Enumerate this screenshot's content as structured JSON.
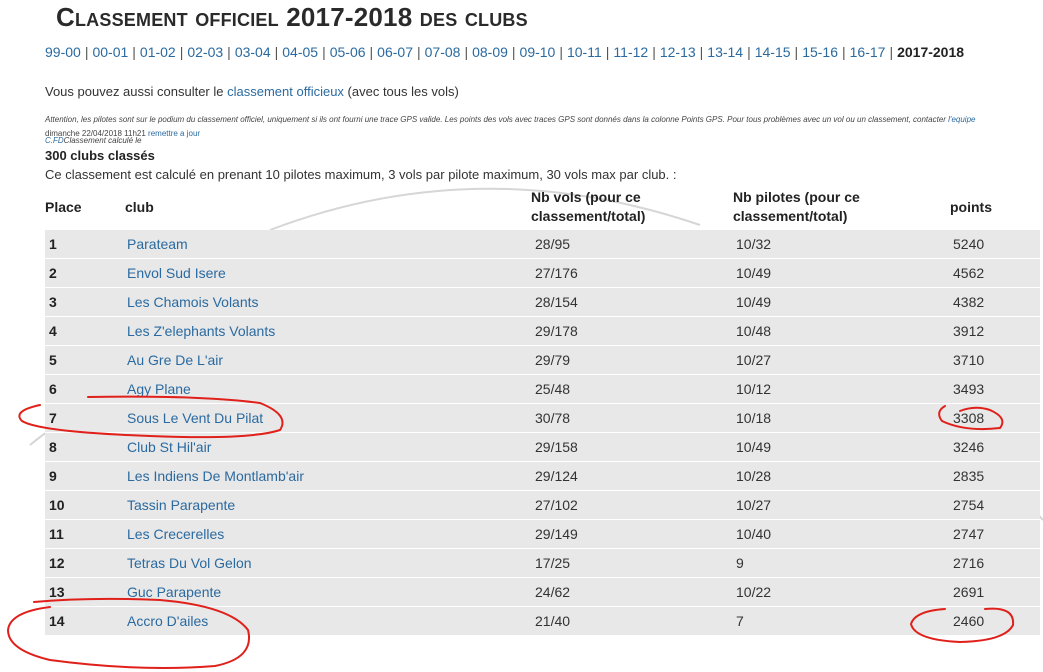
{
  "title": {
    "first_letter": "C",
    "rest": "lassement officiel 2017-2018 des clubs"
  },
  "seasons": [
    "99-00",
    "00-01",
    "01-02",
    "02-03",
    "03-04",
    "04-05",
    "05-06",
    "06-07",
    "07-08",
    "08-09",
    "09-10",
    "10-11",
    "11-12",
    "12-13",
    "13-14",
    "14-15",
    "15-16",
    "16-17"
  ],
  "current_season": "2017-2018",
  "consult": {
    "prefix": "Vous pouvez aussi consulter le ",
    "link": "classement officieux",
    "suffix": " (avec tous les vols)"
  },
  "warning": {
    "text": "Attention, les pilotes sont sur le podium du classement officiel, uniquement si ils ont fourni une trace GPS valide. Les points des vols avec traces GPS sont donnés dans la colonne Points GPS.  Pour tous problèmes avec un vol ou un classement, contacter ",
    "link": "l'equipe C.FD",
    "after": "Classement calculé le",
    "date": "dimanche 22/04/2018 11h21 ",
    "update_link": "remettre a jour"
  },
  "count_label": "300 clubs classés",
  "calc_info": "Ce classement est calculé en prenant 10 pilotes maximum, 3 vols par pilote maximum, 30 vols max par club. :",
  "headers": {
    "place": "Place",
    "club": "club",
    "vols": "Nb vols (pour ce classement/total)",
    "pilotes": "Nb pilotes (pour ce classement/total)",
    "points": "points"
  },
  "rows": [
    {
      "place": "1",
      "club": "Parateam",
      "vols": "28/95",
      "pilotes": "10/32",
      "points": "5240"
    },
    {
      "place": "2",
      "club": "Envol Sud Isere",
      "vols": "27/176",
      "pilotes": "10/49",
      "points": "4562"
    },
    {
      "place": "3",
      "club": "Les Chamois Volants",
      "vols": "28/154",
      "pilotes": "10/49",
      "points": "4382"
    },
    {
      "place": "4",
      "club": "Les Z'elephants Volants",
      "vols": "29/178",
      "pilotes": "10/48",
      "points": "3912"
    },
    {
      "place": "5",
      "club": "Au Gre De L'air",
      "vols": "29/79",
      "pilotes": "10/27",
      "points": "3710"
    },
    {
      "place": "6",
      "club": "Agy Plane",
      "vols": "25/48",
      "pilotes": "10/12",
      "points": "3493"
    },
    {
      "place": "7",
      "club": "Sous Le Vent Du Pilat",
      "vols": "30/78",
      "pilotes": "10/18",
      "points": "3308"
    },
    {
      "place": "8",
      "club": "Club St Hil'air",
      "vols": "29/158",
      "pilotes": "10/49",
      "points": "3246"
    },
    {
      "place": "9",
      "club": "Les Indiens De Montlamb'air",
      "vols": "29/124",
      "pilotes": "10/28",
      "points": "2835"
    },
    {
      "place": "10",
      "club": "Tassin Parapente",
      "vols": "27/102",
      "pilotes": "10/27",
      "points": "2754"
    },
    {
      "place": "11",
      "club": "Les Crecerelles",
      "vols": "29/149",
      "pilotes": "10/40",
      "points": "2747"
    },
    {
      "place": "12",
      "club": "Tetras Du Vol Gelon",
      "vols": "17/25",
      "pilotes": "9",
      "points": "2716"
    },
    {
      "place": "13",
      "club": "Guc Parapente",
      "vols": "24/62",
      "pilotes": "10/22",
      "points": "2691"
    },
    {
      "place": "14",
      "club": "Accro D'ailes",
      "vols": "21/40",
      "pilotes": "7",
      "points": "2460"
    }
  ],
  "colors": {
    "link": "#2a6aa0",
    "row_bg": "#e8e8e8",
    "annotation": "#e0201a"
  }
}
